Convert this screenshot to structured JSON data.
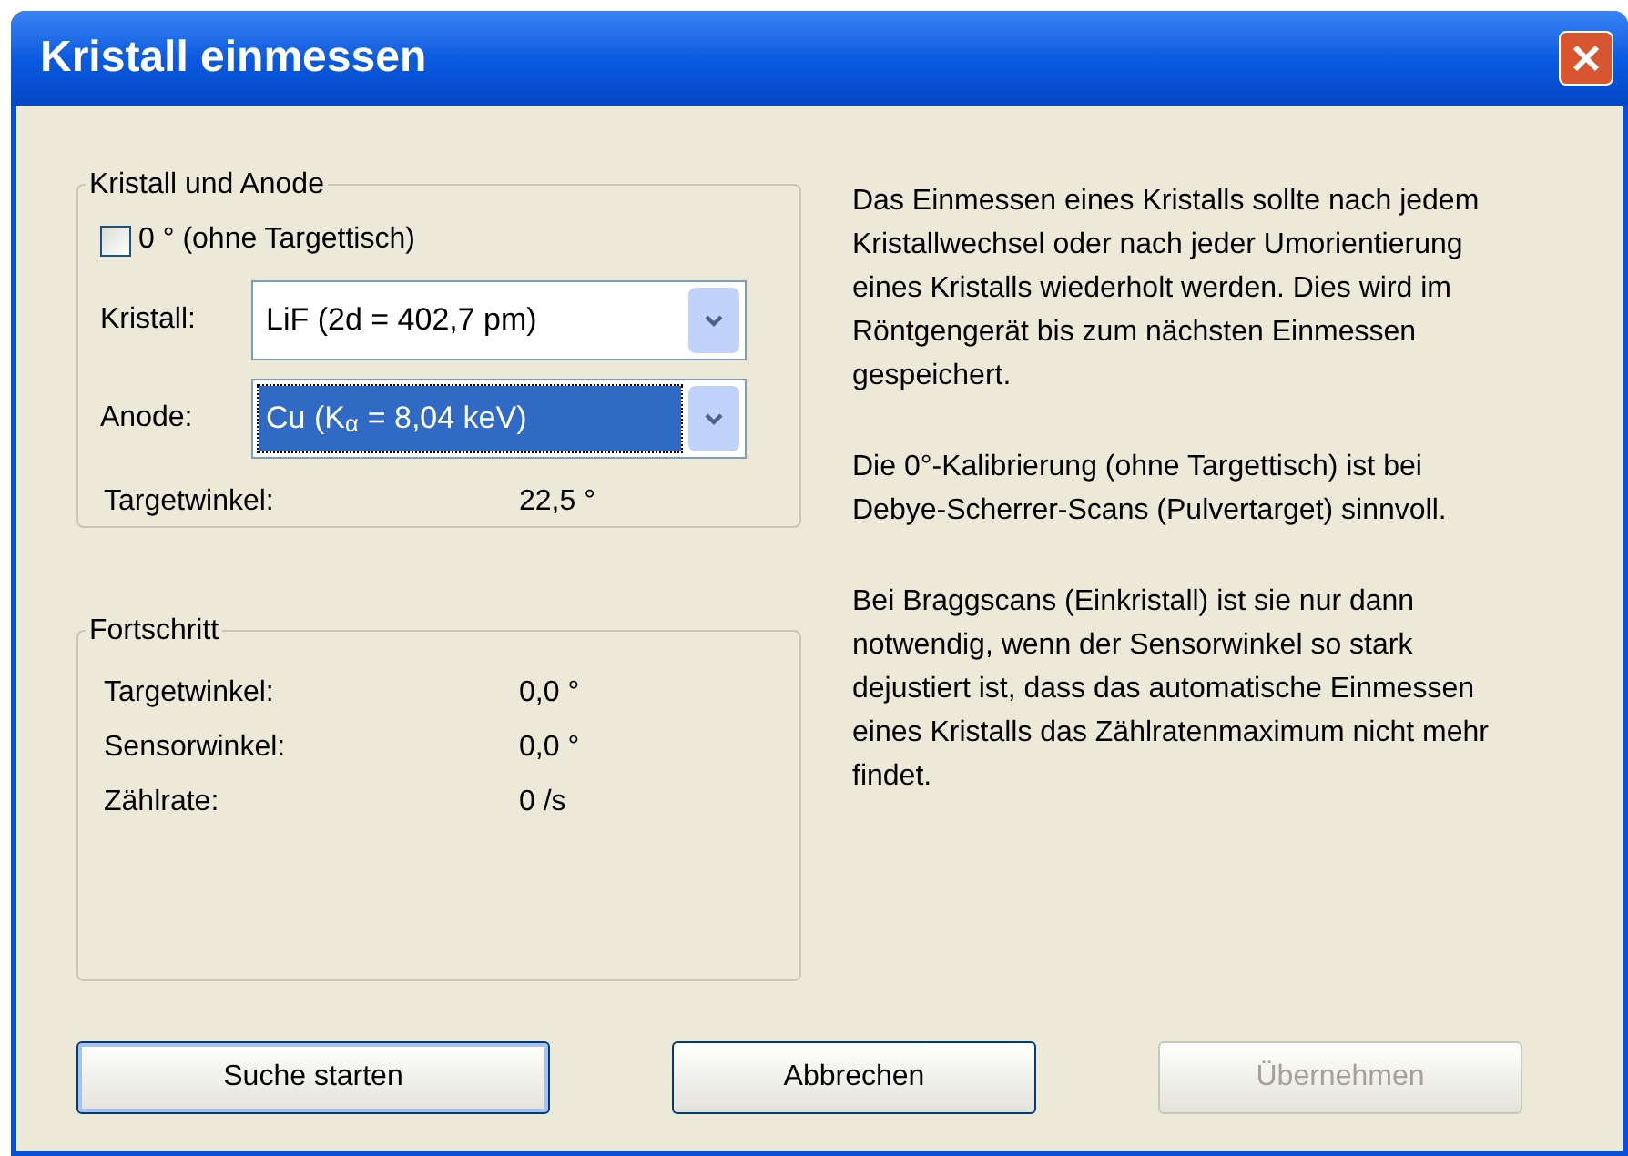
{
  "window": {
    "title": "Kristall einmessen"
  },
  "crystal_group": {
    "title": "Kristall und Anode",
    "checkbox": {
      "label": "0 ° (ohne Targettisch)",
      "checked": false
    },
    "fields": [
      {
        "label": "Kristall:",
        "value": "LiF (2d = 402,7 pm)",
        "focused": false
      },
      {
        "label": "Anode:",
        "value": "Cu (K$_{α}$ = 8,04 keV)",
        "focused": true
      }
    ],
    "readout": {
      "label": "Targetwinkel:",
      "value": "22,5 °"
    }
  },
  "progress_group": {
    "title": "Fortschritt",
    "rows": [
      {
        "label": "Targetwinkel:",
        "value": "0,0 °"
      },
      {
        "label": "Sensorwinkel:",
        "value": "0,0 °"
      },
      {
        "label": "Zählrate:",
        "value": "0 /s"
      }
    ]
  },
  "info": [
    "Das Einmessen eines Kristalls sollte nach jedem Kristallwechsel oder nach jeder Umorientierung eines Kristalls wiederholt werden. Dies wird im Röntgengerät bis zum nächsten Einmessen gespeichert.",
    "Die 0°-Kalibrierung (ohne Targettisch) ist bei Debye-Scherrer-Scans (Pulvertarget) sinnvoll.",
    "Bei Braggscans (Einkristall) ist sie nur dann notwendig, wenn der Sensorwinkel so stark dejustiert ist, dass das automatische Einmessen eines Kristalls das Zählratenmaximum nicht mehr findet."
  ],
  "buttons": [
    {
      "label": "Suche starten",
      "disabled": false,
      "default": true
    },
    {
      "label": "Abbrechen",
      "disabled": false,
      "default": false
    },
    {
      "label": "Übernehmen",
      "disabled": true,
      "default": false
    }
  ]
}
